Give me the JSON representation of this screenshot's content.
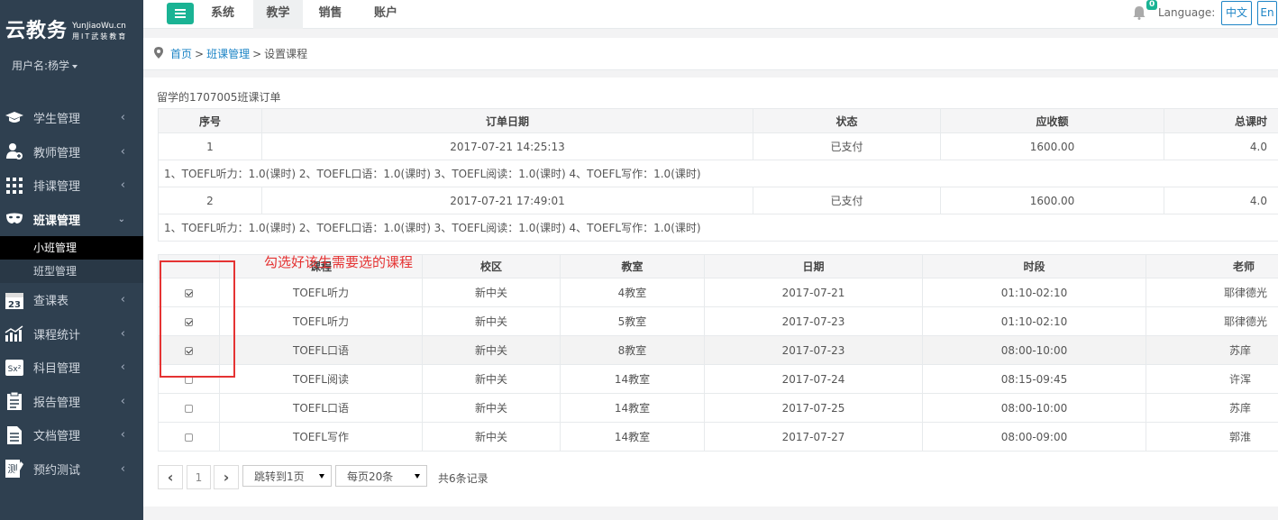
{
  "sidebar": {
    "logo_main": "云教务",
    "logo_en": "YunJiaoWu.cn",
    "logo_cn": "用IT武装教育",
    "user": "用户名:杨学",
    "items": [
      {
        "label": "学生管理",
        "icon": "graduation-cap-icon"
      },
      {
        "label": "教师管理",
        "icon": "teacher-add-icon"
      },
      {
        "label": "排课管理",
        "icon": "grid-icon"
      },
      {
        "label": "班课管理",
        "icon": "mask-icon"
      },
      {
        "label": "查课表",
        "icon": "calendar-icon"
      },
      {
        "label": "课程统计",
        "icon": "stats-icon"
      },
      {
        "label": "科目管理",
        "icon": "formula-icon"
      },
      {
        "label": "报告管理",
        "icon": "clipboard-icon"
      },
      {
        "label": "文档管理",
        "icon": "document-icon"
      },
      {
        "label": "预约测试",
        "icon": "test-icon"
      }
    ],
    "sub_items": [
      "小班管理",
      "班型管理"
    ]
  },
  "topnav": {
    "tabs": [
      "系统",
      "教学",
      "销售",
      "账户"
    ],
    "active_tab": "教学",
    "notification_count": "0",
    "language_label": "Language:",
    "lang_cn": "中文",
    "lang_en": "En"
  },
  "breadcrumb": {
    "home": "首页",
    "section": "班课管理",
    "current": "设置课程",
    "sep": ">"
  },
  "order": {
    "title": "留学的1707005班课订单",
    "headers": [
      "序号",
      "订单日期",
      "状态",
      "应收额",
      "总课时"
    ],
    "rows": [
      {
        "no": "1",
        "date": "2017-07-21 14:25:13",
        "status": "已支付",
        "amount": "1600.00",
        "hours": "4.0",
        "detail": "1、TOEFL听力：1.0(课时) 2、TOEFL口语：1.0(课时) 3、TOEFL阅读：1.0(课时) 4、TOEFL写作：1.0(课时)"
      },
      {
        "no": "2",
        "date": "2017-07-21 17:49:01",
        "status": "已支付",
        "amount": "1600.00",
        "hours": "4.0",
        "detail": "1、TOEFL听力：1.0(课时) 2、TOEFL口语：1.0(课时) 3、TOEFL阅读：1.0(课时) 4、TOEFL写作：1.0(课时)"
      }
    ]
  },
  "courses": {
    "headers": [
      "",
      "课程",
      "校区",
      "教室",
      "日期",
      "时段",
      "老师"
    ],
    "rows": [
      {
        "checked": true,
        "course": "TOEFL听力",
        "campus": "新中关",
        "room": "4教室",
        "date": "2017-07-21",
        "time": "01:10-02:10",
        "teacher": "耶律德光"
      },
      {
        "checked": true,
        "course": "TOEFL听力",
        "campus": "新中关",
        "room": "5教室",
        "date": "2017-07-23",
        "time": "01:10-02:10",
        "teacher": "耶律德光"
      },
      {
        "checked": true,
        "course": "TOEFL口语",
        "campus": "新中关",
        "room": "8教室",
        "date": "2017-07-23",
        "time": "08:00-10:00",
        "teacher": "苏庠"
      },
      {
        "checked": false,
        "course": "TOEFL阅读",
        "campus": "新中关",
        "room": "14教室",
        "date": "2017-07-24",
        "time": "08:15-09:45",
        "teacher": "许浑"
      },
      {
        "checked": false,
        "course": "TOEFL口语",
        "campus": "新中关",
        "room": "14教室",
        "date": "2017-07-25",
        "time": "08:00-10:00",
        "teacher": "苏庠"
      },
      {
        "checked": false,
        "course": "TOEFL写作",
        "campus": "新中关",
        "room": "14教室",
        "date": "2017-07-27",
        "time": "08:00-09:00",
        "teacher": "郭淮"
      }
    ]
  },
  "annotation": "勾选好该生需要选的课程",
  "pagination": {
    "prev": "‹",
    "page": "1",
    "next": "›",
    "jump": "跳转到1页",
    "per_page": "每页20条",
    "total": "共6条记录"
  }
}
